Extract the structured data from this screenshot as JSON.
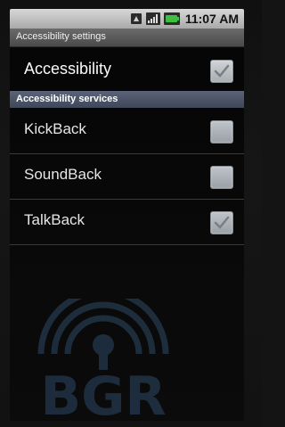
{
  "status_bar": {
    "time": "11:07 AM",
    "icons": [
      "network-icon",
      "signal-icon",
      "battery-icon"
    ]
  },
  "title_bar": {
    "title": "Accessibility settings"
  },
  "main_setting": {
    "label": "Accessibility",
    "checked": true
  },
  "section": {
    "header": "Accessibility services"
  },
  "services": [
    {
      "label": "KickBack",
      "checked": false
    },
    {
      "label": "SoundBack",
      "checked": false
    },
    {
      "label": "TalkBack",
      "checked": true
    }
  ],
  "watermark": {
    "text": "BGR"
  },
  "colors": {
    "status_bar": "#b5b5b5",
    "title_bar": "#5a5a5a",
    "section_header": "#4a5368",
    "checkbox": "#b0b5ba",
    "battery": "#3fbf3f"
  }
}
